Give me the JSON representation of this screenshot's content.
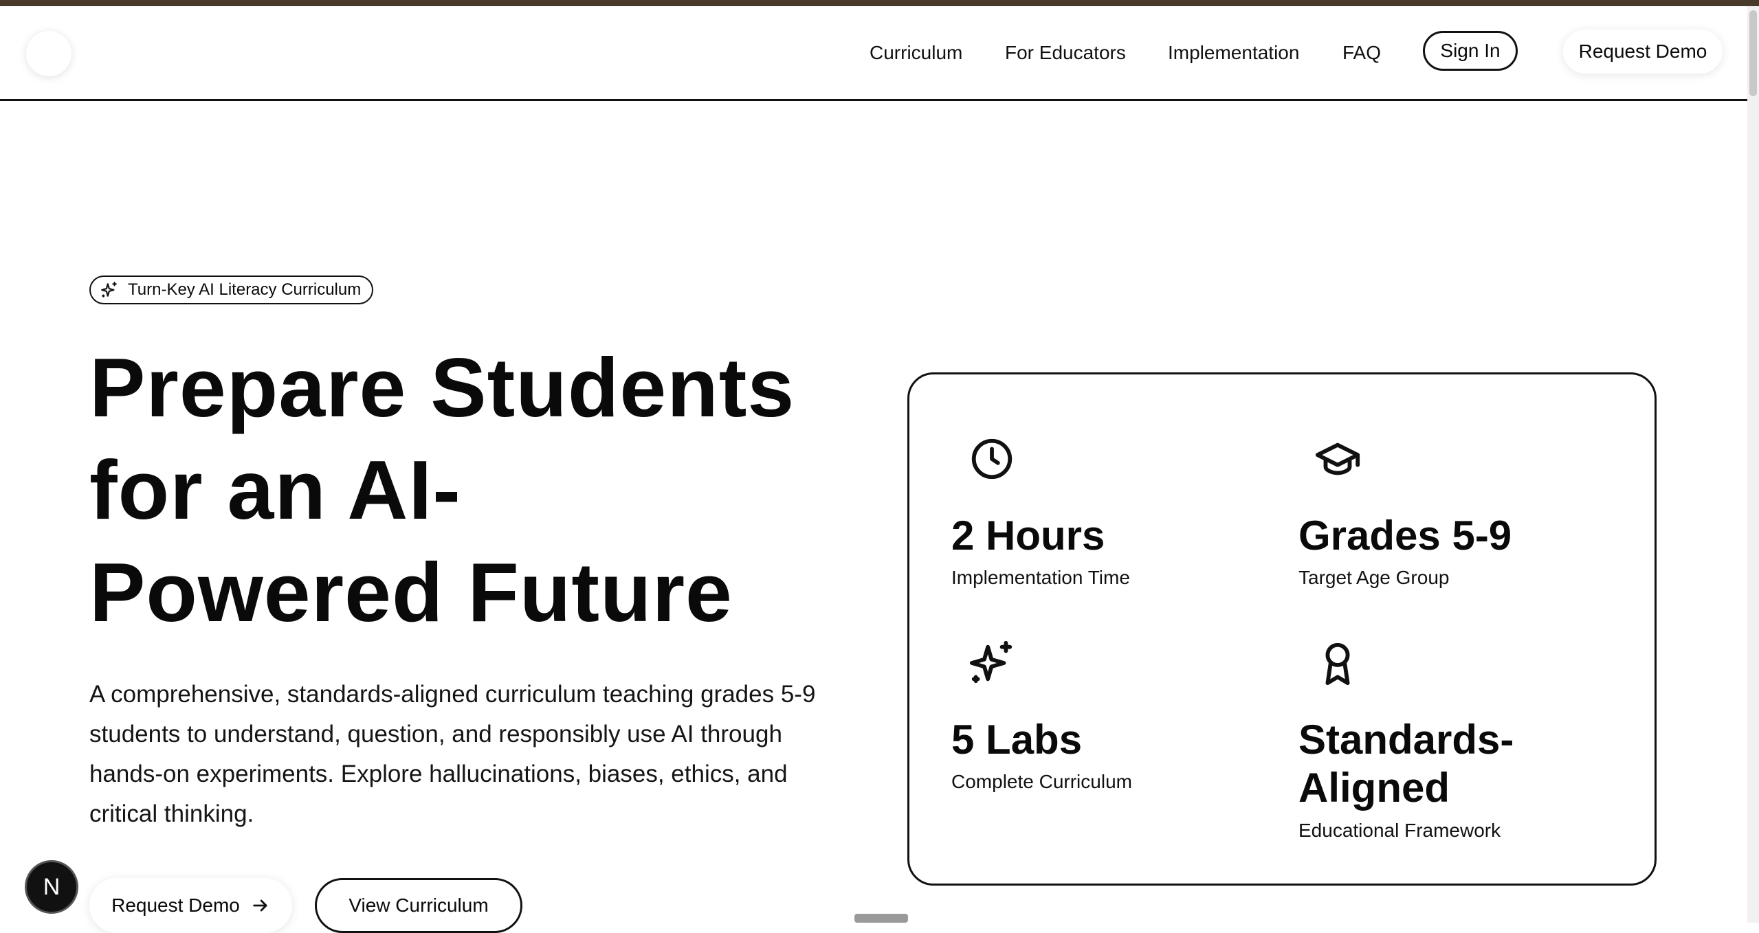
{
  "nav": {
    "links": [
      "Curriculum",
      "For Educators",
      "Implementation",
      "FAQ"
    ],
    "sign_in": "Sign In",
    "request_demo": "Request Demo"
  },
  "hero": {
    "badge": "Turn-Key AI Literacy Curriculum",
    "title_lines": [
      "Prepare Students",
      "for an AI-",
      "Powered Future"
    ],
    "description": "A comprehensive, standards-aligned curriculum teaching grades 5-9 students to understand, question, and responsibly use AI through hands-on experiments. Explore hallucinations, biases, ethics, and critical thinking.",
    "primary_button": "Request Demo",
    "secondary_button": "View Curriculum"
  },
  "stats": [
    {
      "icon": "clock-icon",
      "value": "2 Hours",
      "label": "Implementation Time"
    },
    {
      "icon": "graduation-cap-icon",
      "value": "Grades 5-9",
      "label": "Target Age Group"
    },
    {
      "icon": "sparkles-icon",
      "value": "5 Labs",
      "label": "Complete Curriculum"
    },
    {
      "icon": "award-icon",
      "value_lines": [
        "Standards-",
        "Aligned"
      ],
      "label": "Educational Framework"
    }
  ],
  "dev_badge": "N",
  "colors": {
    "top_bar": "#4a3a2a",
    "text": "#0a0a0a",
    "border": "#111111"
  }
}
